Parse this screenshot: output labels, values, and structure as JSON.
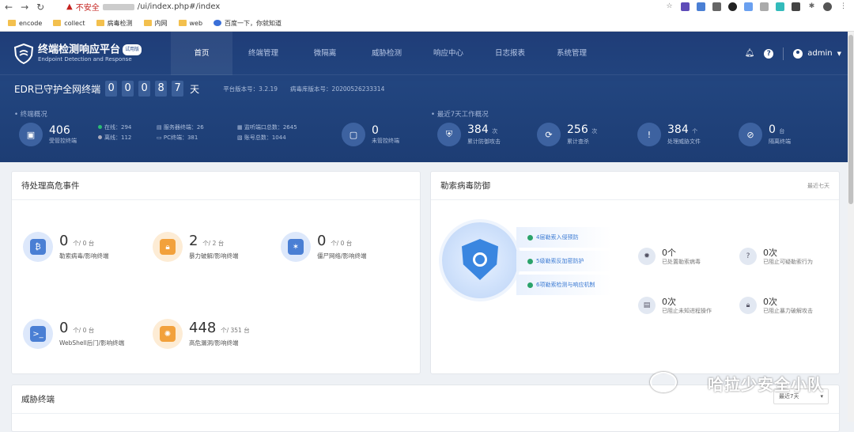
{
  "browser": {
    "back": "←",
    "forward": "→",
    "reload": "↻",
    "warning_text": "不安全",
    "url": "/ui/index.php#/index"
  },
  "bookmarks": [
    "encode",
    "collect",
    "病毒检测",
    "内网",
    "web",
    "百度一下，你就知道"
  ],
  "app": {
    "title": "终端检测响应平台",
    "subtitle": "Endpoint Detection and Response",
    "badge": "试用版"
  },
  "nav": [
    "首页",
    "终端管理",
    "微隔离",
    "威胁检测",
    "响应中心",
    "日志报表",
    "系统管理"
  ],
  "user": {
    "name": "admin"
  },
  "header": {
    "label": "EDR已守护全网终端",
    "digits": [
      "0",
      "0",
      "0",
      "8",
      "7"
    ],
    "unit": "天",
    "platform": "平台版本号：3.2.19",
    "virus": "病毒库版本号：20200526233314"
  },
  "overview": {
    "title": "终端概况",
    "managed": "406",
    "managed_label": "受管控终端",
    "online": "在线：294",
    "offline": "离线：112",
    "server": "服务器终端：26",
    "pc": "PC终端：381",
    "ports": "监听端口总数：2645",
    "accounts": "账号总数：1044",
    "unmanaged": "0",
    "unmanaged_label": "未管控终端"
  },
  "week": {
    "title": "最近7天工作概况",
    "items": [
      {
        "num": "384",
        "unit": "次",
        "label": "累计防御攻击"
      },
      {
        "num": "256",
        "unit": "次",
        "label": "累计查杀"
      },
      {
        "num": "384",
        "unit": "个",
        "label": "处理威胁文件"
      },
      {
        "num": "0",
        "unit": "台",
        "label": "隔离终端"
      }
    ]
  },
  "events": {
    "title": "待处理高危事件",
    "items": [
      {
        "num": "0",
        "unit": "个/ 0 台",
        "label": "勒索病毒/影响终端",
        "icon": "bitcoin-icon"
      },
      {
        "num": "2",
        "unit": "个/ 2 台",
        "label": "暴力破解/影响终端",
        "icon": "lock-icon"
      },
      {
        "num": "0",
        "unit": "个/ 0 台",
        "label": "僵尸网络/影响终端",
        "icon": "botnet-icon"
      },
      {
        "num": "0",
        "unit": "个/ 0 台",
        "label": "WebShell后门/影响终端",
        "icon": "terminal-icon"
      },
      {
        "num": "448",
        "unit": "个/ 351 台",
        "label": "高危漏洞/影响终端",
        "icon": "bug-icon"
      }
    ]
  },
  "ransom": {
    "title": "勒索病毒防御",
    "range": "最近七天",
    "layers": [
      "4层勒索入侵预防",
      "5级勒索反加密防护",
      "6项勒索检测与响应机制"
    ],
    "stats": [
      {
        "num": "0个",
        "label": "已处置勒索病毒"
      },
      {
        "num": "0次",
        "label": "已阻止可疑勒索行为"
      },
      {
        "num": "0次",
        "label": "已阻止未知进程操作"
      },
      {
        "num": "0次",
        "label": "已阻止暴力破解攻击"
      }
    ]
  },
  "threat": {
    "title": "威胁终端",
    "range": "最近7天"
  },
  "watermark": "哈拉少安全小队"
}
